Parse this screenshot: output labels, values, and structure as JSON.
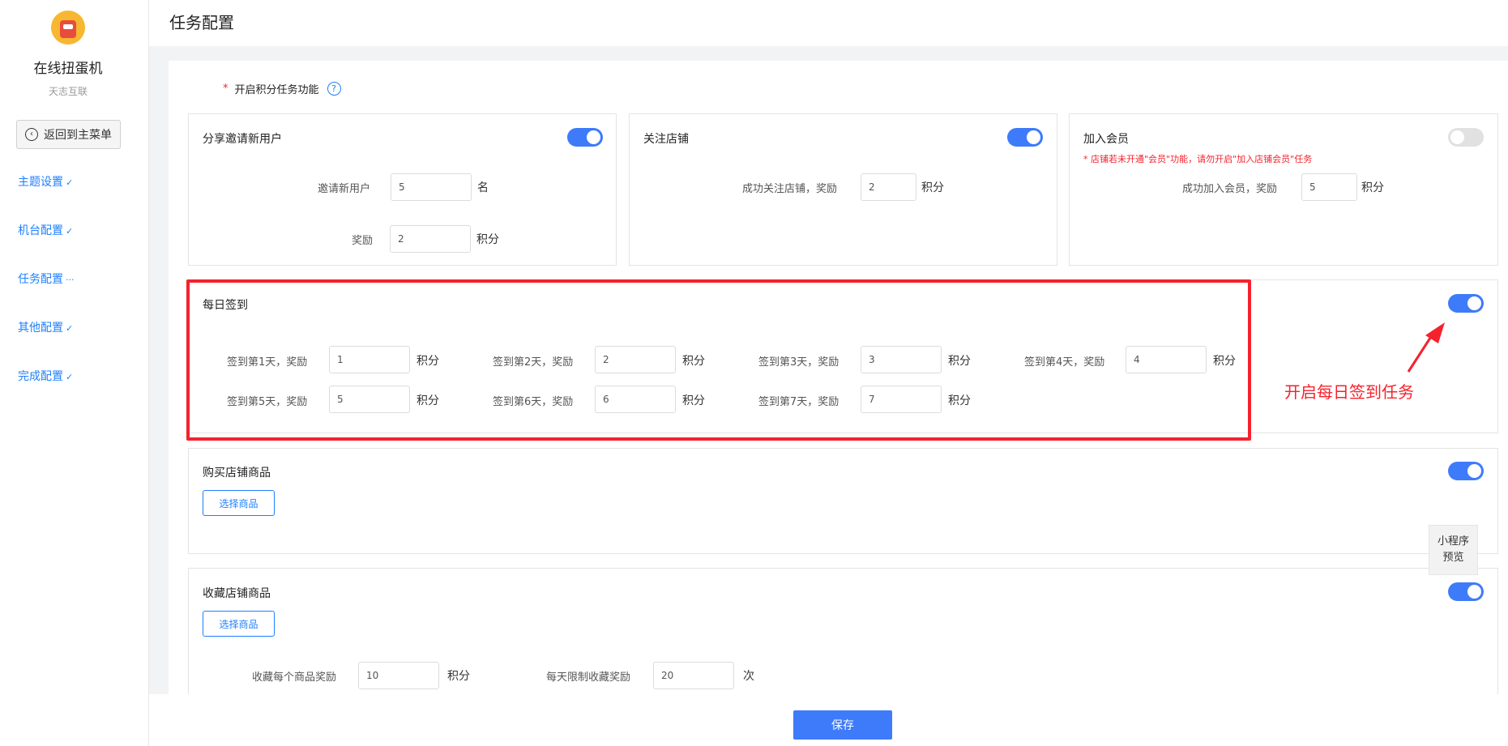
{
  "sidebar": {
    "app_name": "在线扭蛋机",
    "app_sub": "天志互联",
    "back_label": "返回到主菜单",
    "items": [
      {
        "label": "主题设置",
        "mark": "✓"
      },
      {
        "label": "机台配置",
        "mark": "✓"
      },
      {
        "label": "任务配置",
        "mark": "···"
      },
      {
        "label": "其他配置",
        "mark": "✓"
      },
      {
        "label": "完成配置",
        "mark": "✓"
      }
    ]
  },
  "page_title": "任务配置",
  "master_toggle": {
    "required_mark": "*",
    "label": "开启积分任务功能",
    "help": "?"
  },
  "share": {
    "title": "分享邀请新用户",
    "enabled": true,
    "invite_label": "邀请新用户",
    "invite_value": "5",
    "invite_unit": "名",
    "reward_label": "奖励",
    "reward_value": "2",
    "reward_unit": "积分"
  },
  "follow": {
    "title": "关注店铺",
    "enabled": true,
    "label": "成功关注店铺，奖励",
    "value": "2",
    "unit": "积分"
  },
  "member": {
    "title": "加入会员",
    "enabled": false,
    "warning": "* 店铺若未开通\"会员\"功能，请勿开启\"加入店铺会员\"任务",
    "label": "成功加入会员，奖励",
    "value": "5",
    "unit": "积分"
  },
  "daily": {
    "title": "每日签到",
    "enabled": true,
    "unit": "积分",
    "days": [
      {
        "label": "签到第1天，奖励",
        "value": "1"
      },
      {
        "label": "签到第2天，奖励",
        "value": "2"
      },
      {
        "label": "签到第3天，奖励",
        "value": "3"
      },
      {
        "label": "签到第4天，奖励",
        "value": "4"
      },
      {
        "label": "签到第5天，奖励",
        "value": "5"
      },
      {
        "label": "签到第6天，奖励",
        "value": "6"
      },
      {
        "label": "签到第7天，奖励",
        "value": "7"
      }
    ]
  },
  "annotation": {
    "text": "开启每日签到任务",
    "color": "#f5222d"
  },
  "buy": {
    "title": "购买店铺商品",
    "enabled": true,
    "select_label": "选择商品"
  },
  "collect": {
    "title": "收藏店铺商品",
    "enabled": true,
    "select_label": "选择商品",
    "per_item_label": "收藏每个商品奖励",
    "per_item_value": "10",
    "per_item_unit": "积分",
    "daily_limit_label": "每天限制收藏奖励",
    "daily_limit_value": "20",
    "daily_limit_unit": "次"
  },
  "preview": {
    "line1": "小程序",
    "line2": "预览"
  },
  "save_label": "保存",
  "colors": {
    "accent": "#3e7bfa",
    "link": "#1e80ff",
    "danger": "#f5222d"
  }
}
